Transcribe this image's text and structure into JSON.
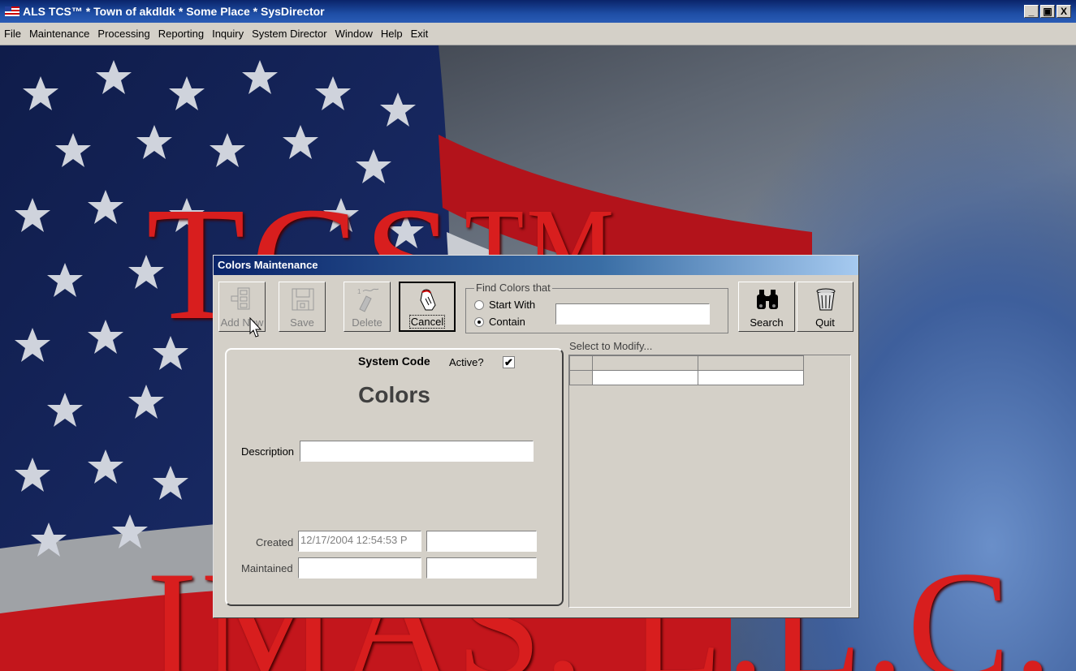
{
  "window": {
    "title": "ALS TCS™ * Town of akdldk * Some Place * SysDirector",
    "controls": {
      "minimize": "_",
      "restore": "▣",
      "close": "X"
    }
  },
  "menu": [
    "File",
    "Maintenance",
    "Processing",
    "Reporting",
    "Inquiry",
    "System Director",
    "Window",
    "Help",
    "Exit"
  ],
  "background": {
    "line1": "TCS™",
    "line2": "IMAS, L.L.C."
  },
  "dialog": {
    "title": "Colors Maintenance",
    "toolbar": {
      "add_new": "Add New",
      "save": "Save",
      "delete": "Delete",
      "cancel": "Cancel",
      "search": "Search",
      "quit": "Quit"
    },
    "find": {
      "legend": "Find Colors that",
      "start_with": "Start With",
      "contain": "Contain",
      "selected": "contain",
      "value": ""
    },
    "form": {
      "system_code_label": "System Code",
      "active_label": "Active?",
      "active_checked": true,
      "heading": "Colors",
      "description_label": "Description",
      "description_value": "",
      "created_label": "Created",
      "created_value": "12/17/2004 12:54:53 P",
      "created_by": "",
      "maintained_label": "Maintained",
      "maintained_value": "",
      "maintained_by": ""
    },
    "list": {
      "caption": "Select to Modify..."
    }
  }
}
